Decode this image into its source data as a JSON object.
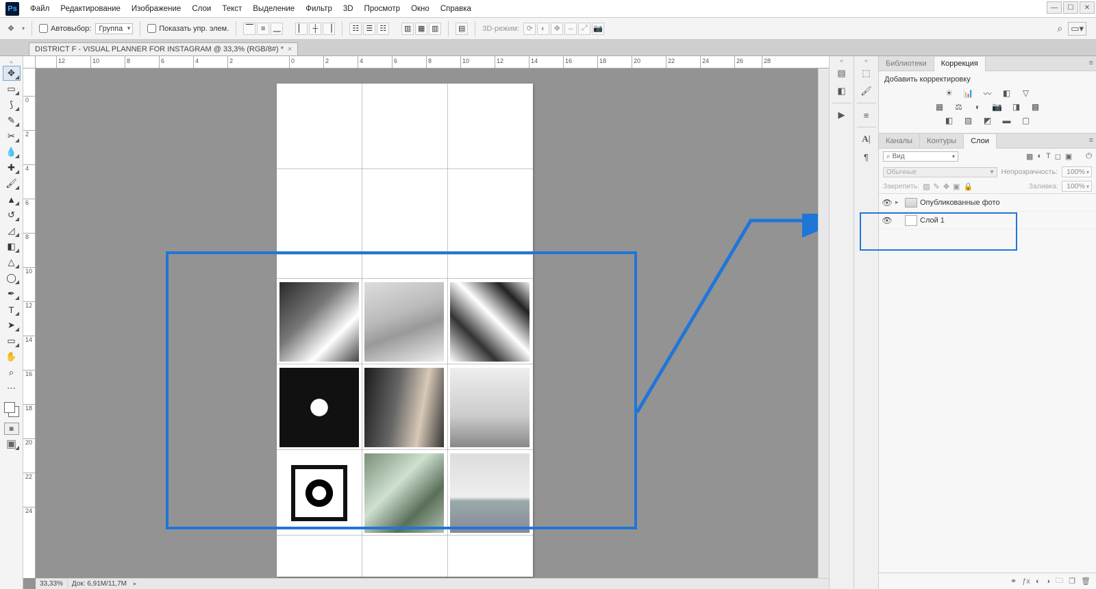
{
  "menu": {
    "items": [
      "Файл",
      "Редактирование",
      "Изображение",
      "Слои",
      "Текст",
      "Выделение",
      "Фильтр",
      "3D",
      "Просмотр",
      "Окно",
      "Справка"
    ]
  },
  "options": {
    "autoselect_label": "Автовыбор:",
    "autoselect_value": "Группа",
    "show_controls": "Показать упр. элем.",
    "mode3d_label": "3D-режим:"
  },
  "tab": {
    "title": "DISTRICT F -  VISUAL PLANNER FOR INSTAGRAM @ 33,3% (RGB/8#) *"
  },
  "ruler": {
    "h": [
      "12",
      "10",
      "8",
      "6",
      "4",
      "2",
      "0",
      "2",
      "4",
      "6",
      "8",
      "10",
      "12",
      "14",
      "16",
      "18",
      "20",
      "22",
      "24",
      "26",
      "28"
    ],
    "v": [
      "0",
      "2",
      "4",
      "6",
      "8",
      "10",
      "12",
      "14",
      "16",
      "18",
      "20",
      "22",
      "24"
    ]
  },
  "right": {
    "tabs1": {
      "lib": "Библиотеки",
      "corr": "Коррекция"
    },
    "corr_title": "Добавить корректировку",
    "tabs2": {
      "chan": "Каналы",
      "paths": "Контуры",
      "layers": "Слои"
    },
    "kind": "Вид",
    "blend": "Обычные",
    "opacity_label": "Непрозрачность:",
    "opacity_value": "100%",
    "lock_label": "Закрепить:",
    "fill_label": "Заливка:",
    "fill_value": "100%",
    "layers": [
      {
        "name": "Опубликованные фото",
        "type": "group"
      },
      {
        "name": "Слой 1",
        "type": "layer"
      }
    ]
  },
  "status": {
    "zoom": "33,33%",
    "doc": "Док: 6,91M/11,7M"
  },
  "colors": {
    "accent": "#1f76d8"
  }
}
